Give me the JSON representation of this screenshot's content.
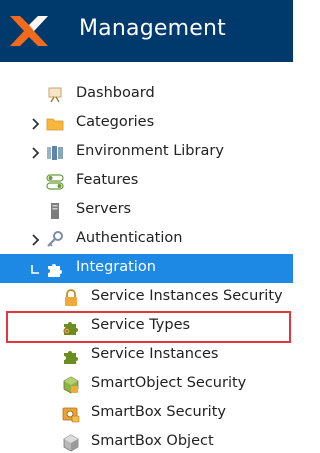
{
  "header": {
    "title": "Management",
    "background": "#003a6c",
    "logo_colors": [
      "#f26a1b",
      "#ffffff"
    ]
  },
  "tree": {
    "selected_color": "#1e88e5",
    "items": [
      {
        "label": "Dashboard",
        "icon": "easel-icon",
        "expandable": false
      },
      {
        "label": "Categories",
        "icon": "folder-icon",
        "expandable": true,
        "state": "collapsed"
      },
      {
        "label": "Environment Library",
        "icon": "library-icon",
        "expandable": true,
        "state": "collapsed"
      },
      {
        "label": "Features",
        "icon": "toggle-icon",
        "expandable": false
      },
      {
        "label": "Servers",
        "icon": "server-icon",
        "expandable": false
      },
      {
        "label": "Authentication",
        "icon": "key-icon",
        "expandable": true,
        "state": "collapsed"
      },
      {
        "label": "Integration",
        "icon": "puzzle-icon",
        "expandable": true,
        "state": "expanded",
        "selected": true
      },
      {
        "label": "Service Instances Security",
        "icon": "padlock-icon"
      },
      {
        "label": "Service Types",
        "icon": "puzzle-gear-icon",
        "highlighted": true
      },
      {
        "label": "Service Instances",
        "icon": "puzzle-icon"
      },
      {
        "label": "SmartObject Security",
        "icon": "cube-lock-icon"
      },
      {
        "label": "SmartBox Security",
        "icon": "smartbox-lock-icon"
      },
      {
        "label": "SmartBox Object",
        "icon": "cube-icon"
      }
    ]
  }
}
